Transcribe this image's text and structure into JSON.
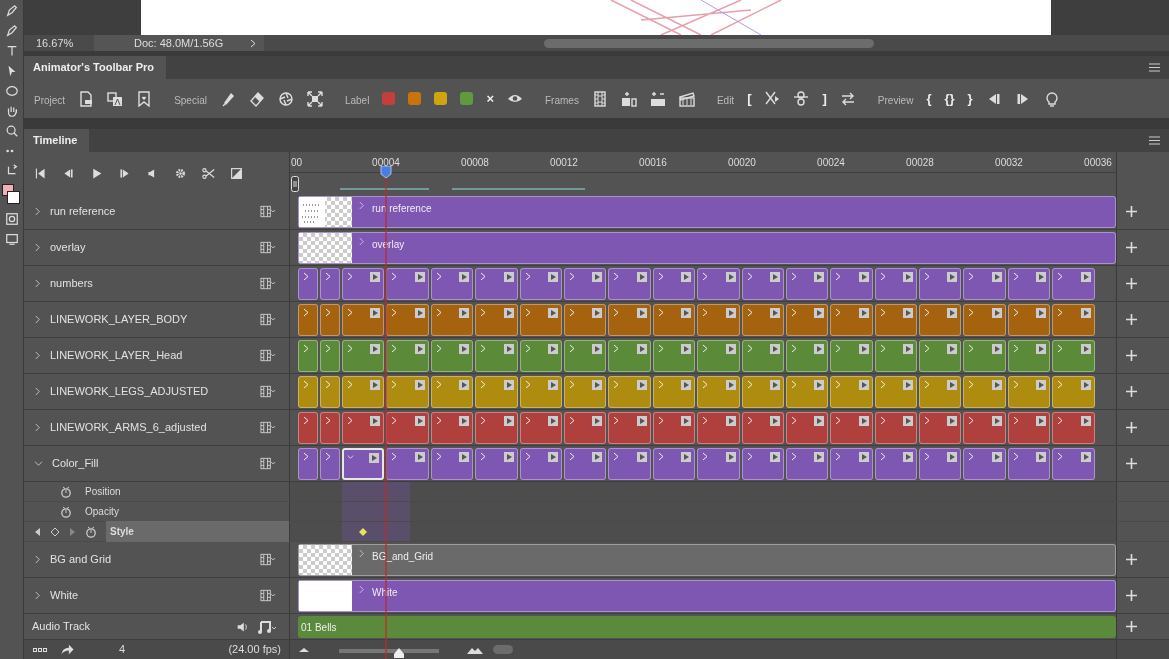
{
  "status_bar": {
    "zoom": "16.67%",
    "doc_info": "Doc: 48.0M/1.56G"
  },
  "toolbar_panel": {
    "title": "Animator's Toolbar Pro",
    "groups": [
      {
        "label": "Project",
        "items": [
          {
            "kind": "doc"
          },
          {
            "kind": "doc-letter"
          },
          {
            "kind": "bookmark"
          }
        ]
      },
      {
        "label": "Special",
        "items": [
          {
            "kind": "pen"
          },
          {
            "kind": "eraser"
          },
          {
            "kind": "aperture"
          },
          {
            "kind": "fit"
          }
        ]
      },
      {
        "label": "Label",
        "items": [
          {
            "kind": "swatch",
            "color": "#c2403c"
          },
          {
            "kind": "swatch",
            "color": "#c7740f"
          },
          {
            "kind": "swatch",
            "color": "#cfa40f"
          },
          {
            "kind": "swatch",
            "color": "#5f9a3c"
          },
          {
            "kind": "char",
            "text": "×"
          },
          {
            "kind": "eye"
          }
        ]
      },
      {
        "label": "Frames",
        "items": [
          {
            "kind": "film"
          },
          {
            "kind": "add-frame"
          },
          {
            "kind": "add-remove"
          },
          {
            "kind": "clapper"
          }
        ]
      },
      {
        "label": "Edit",
        "items": [
          {
            "kind": "char",
            "text": "["
          },
          {
            "kind": "cut"
          },
          {
            "kind": "onion"
          },
          {
            "kind": "char",
            "text": "]"
          },
          {
            "kind": "swap"
          }
        ]
      },
      {
        "label": "Preview",
        "items": [
          {
            "kind": "char",
            "text": "{"
          },
          {
            "kind": "char",
            "text": "{}"
          },
          {
            "kind": "char",
            "text": "}"
          },
          {
            "kind": "step-back"
          },
          {
            "kind": "step-forward"
          },
          {
            "kind": "bulb"
          }
        ]
      }
    ]
  },
  "timeline": {
    "title": "Timeline",
    "ruler": [
      "00",
      "00004",
      "00008",
      "00012",
      "00016",
      "00020",
      "00024",
      "00028",
      "00032",
      "00036"
    ],
    "tracks": [
      {
        "name": "run reference",
        "expanded": false,
        "kind": "clip",
        "color": "#7e57b3",
        "thumbnail": {
          "kind": "sketch"
        },
        "label": "run reference"
      },
      {
        "name": "overlay",
        "expanded": false,
        "kind": "clip",
        "color": "#7e57b3",
        "thumbnail": {
          "kind": "checker"
        },
        "label": "overlay"
      },
      {
        "name": "numbers",
        "expanded": false,
        "kind": "frames",
        "color": "#7e57b3",
        "frames": [
          {
            "kind": "narrow",
            "selected": false
          },
          {
            "kind": "narrow",
            "selected": false
          },
          {
            "kind": "wide",
            "selected": false
          },
          {
            "kind": "wide",
            "selected": false
          },
          {
            "kind": "wide",
            "selected": false
          },
          {
            "kind": "wide",
            "selected": false
          },
          {
            "kind": "wide",
            "selected": false
          },
          {
            "kind": "wide",
            "selected": false
          },
          {
            "kind": "wide",
            "selected": false
          },
          {
            "kind": "wide",
            "selected": false
          },
          {
            "kind": "wide",
            "selected": false
          },
          {
            "kind": "wide",
            "selected": false
          },
          {
            "kind": "wide",
            "selected": false
          },
          {
            "kind": "wide",
            "selected": false
          },
          {
            "kind": "wide",
            "selected": false
          },
          {
            "kind": "wide",
            "selected": false
          },
          {
            "kind": "wide",
            "selected": false
          },
          {
            "kind": "wide",
            "selected": false
          },
          {
            "kind": "wide",
            "selected": false
          }
        ]
      },
      {
        "name": "LINEWORK_LAYER_BODY",
        "expanded": false,
        "kind": "frames",
        "color": "#a5620f",
        "frames": [
          {
            "kind": "narrow",
            "selected": false
          },
          {
            "kind": "narrow",
            "selected": false
          },
          {
            "kind": "wide",
            "selected": false
          },
          {
            "kind": "wide",
            "selected": false
          },
          {
            "kind": "wide",
            "selected": false
          },
          {
            "kind": "wide",
            "selected": false
          },
          {
            "kind": "wide",
            "selected": false
          },
          {
            "kind": "wide",
            "selected": false
          },
          {
            "kind": "wide",
            "selected": false
          },
          {
            "kind": "wide",
            "selected": false
          },
          {
            "kind": "wide",
            "selected": false
          },
          {
            "kind": "wide",
            "selected": false
          },
          {
            "kind": "wide",
            "selected": false
          },
          {
            "kind": "wide",
            "selected": false
          },
          {
            "kind": "wide",
            "selected": false
          },
          {
            "kind": "wide",
            "selected": false
          },
          {
            "kind": "wide",
            "selected": false
          },
          {
            "kind": "wide",
            "selected": false
          },
          {
            "kind": "wide",
            "selected": false
          }
        ]
      },
      {
        "name": "LINEWORK_LAYER_Head",
        "expanded": false,
        "kind": "frames",
        "color": "#5b8a38",
        "frames": [
          {
            "kind": "narrow",
            "selected": false
          },
          {
            "kind": "narrow",
            "selected": false
          },
          {
            "kind": "wide",
            "selected": false
          },
          {
            "kind": "wide",
            "selected": false
          },
          {
            "kind": "wide",
            "selected": false
          },
          {
            "kind": "wide",
            "selected": false
          },
          {
            "kind": "wide",
            "selected": false
          },
          {
            "kind": "wide",
            "selected": false
          },
          {
            "kind": "wide",
            "selected": false
          },
          {
            "kind": "wide",
            "selected": false
          },
          {
            "kind": "wide",
            "selected": false
          },
          {
            "kind": "wide",
            "selected": false
          },
          {
            "kind": "wide",
            "selected": false
          },
          {
            "kind": "wide",
            "selected": false
          },
          {
            "kind": "wide",
            "selected": false
          },
          {
            "kind": "wide",
            "selected": false
          },
          {
            "kind": "wide",
            "selected": false
          },
          {
            "kind": "wide",
            "selected": false
          },
          {
            "kind": "wide",
            "selected": false
          }
        ]
      },
      {
        "name": "LINEWORK_LEGS_ADJUSTED",
        "expanded": false,
        "kind": "frames",
        "color": "#ad8c10",
        "frames": [
          {
            "kind": "narrow",
            "selected": false
          },
          {
            "kind": "narrow",
            "selected": false
          },
          {
            "kind": "wide",
            "selected": false
          },
          {
            "kind": "wide",
            "selected": false
          },
          {
            "kind": "wide",
            "selected": false
          },
          {
            "kind": "wide",
            "selected": false
          },
          {
            "kind": "wide",
            "selected": false
          },
          {
            "kind": "wide",
            "selected": false
          },
          {
            "kind": "wide",
            "selected": false
          },
          {
            "kind": "wide",
            "selected": false
          },
          {
            "kind": "wide",
            "selected": false
          },
          {
            "kind": "wide",
            "selected": false
          },
          {
            "kind": "wide",
            "selected": false
          },
          {
            "kind": "wide",
            "selected": false
          },
          {
            "kind": "wide",
            "selected": false
          },
          {
            "kind": "wide",
            "selected": false
          },
          {
            "kind": "wide",
            "selected": false
          },
          {
            "kind": "wide",
            "selected": false
          },
          {
            "kind": "wide",
            "selected": false
          }
        ]
      },
      {
        "name": "LINEWORK_ARMS_6_adjusted",
        "expanded": false,
        "kind": "frames",
        "color": "#b0403d",
        "frames": [
          {
            "kind": "narrow",
            "selected": false
          },
          {
            "kind": "narrow",
            "selected": false
          },
          {
            "kind": "wide",
            "selected": false
          },
          {
            "kind": "wide",
            "selected": false
          },
          {
            "kind": "wide",
            "selected": false
          },
          {
            "kind": "wide",
            "selected": false
          },
          {
            "kind": "wide",
            "selected": false
          },
          {
            "kind": "wide",
            "selected": false
          },
          {
            "kind": "wide",
            "selected": false
          },
          {
            "kind": "wide",
            "selected": false
          },
          {
            "kind": "wide",
            "selected": false
          },
          {
            "kind": "wide",
            "selected": false
          },
          {
            "kind": "wide",
            "selected": false
          },
          {
            "kind": "wide",
            "selected": false
          },
          {
            "kind": "wide",
            "selected": false
          },
          {
            "kind": "wide",
            "selected": false
          },
          {
            "kind": "wide",
            "selected": false
          },
          {
            "kind": "wide",
            "selected": false
          },
          {
            "kind": "wide",
            "selected": false
          }
        ]
      },
      {
        "name": "Color_Fill",
        "expanded": true,
        "kind": "frames",
        "color": "#7e57b3",
        "frames": [
          {
            "kind": "narrow",
            "selected": false
          },
          {
            "kind": "narrow",
            "selected": false
          },
          {
            "kind": "wide",
            "selected": true
          },
          {
            "kind": "wide",
            "selected": false
          },
          {
            "kind": "wide",
            "selected": false
          },
          {
            "kind": "wide",
            "selected": false
          },
          {
            "kind": "wide",
            "selected": false
          },
          {
            "kind": "wide",
            "selected": false
          },
          {
            "kind": "wide",
            "selected": false
          },
          {
            "kind": "wide",
            "selected": false
          },
          {
            "kind": "wide",
            "selected": false
          },
          {
            "kind": "wide",
            "selected": false
          },
          {
            "kind": "wide",
            "selected": false
          },
          {
            "kind": "wide",
            "selected": false
          },
          {
            "kind": "wide",
            "selected": false
          },
          {
            "kind": "wide",
            "selected": false
          },
          {
            "kind": "wide",
            "selected": false
          },
          {
            "kind": "wide",
            "selected": false
          },
          {
            "kind": "wide",
            "selected": false
          }
        ],
        "properties": [
          {
            "name": "Position",
            "selected": false,
            "keyframe": false
          },
          {
            "name": "Opacity",
            "selected": false,
            "keyframe": false
          },
          {
            "name": "Style",
            "selected": true,
            "keyframe": true
          }
        ]
      },
      {
        "name": "BG and Grid",
        "expanded": false,
        "kind": "clip",
        "color": "#6a6a6a",
        "thumbnail": {
          "kind": "checker"
        },
        "label": "BG_and_Grid"
      },
      {
        "name": "White",
        "expanded": false,
        "kind": "clip",
        "color": "#7e57b3",
        "thumbnail": {
          "kind": "white"
        },
        "label": "White"
      }
    ],
    "audio": {
      "name": "Audio Track",
      "clip": "01 Bells",
      "color": "#5b8a3d"
    },
    "footer": {
      "frame": "4",
      "fps": "(24.00 fps)",
      "zoom": {
        "level": 0.6
      }
    }
  }
}
